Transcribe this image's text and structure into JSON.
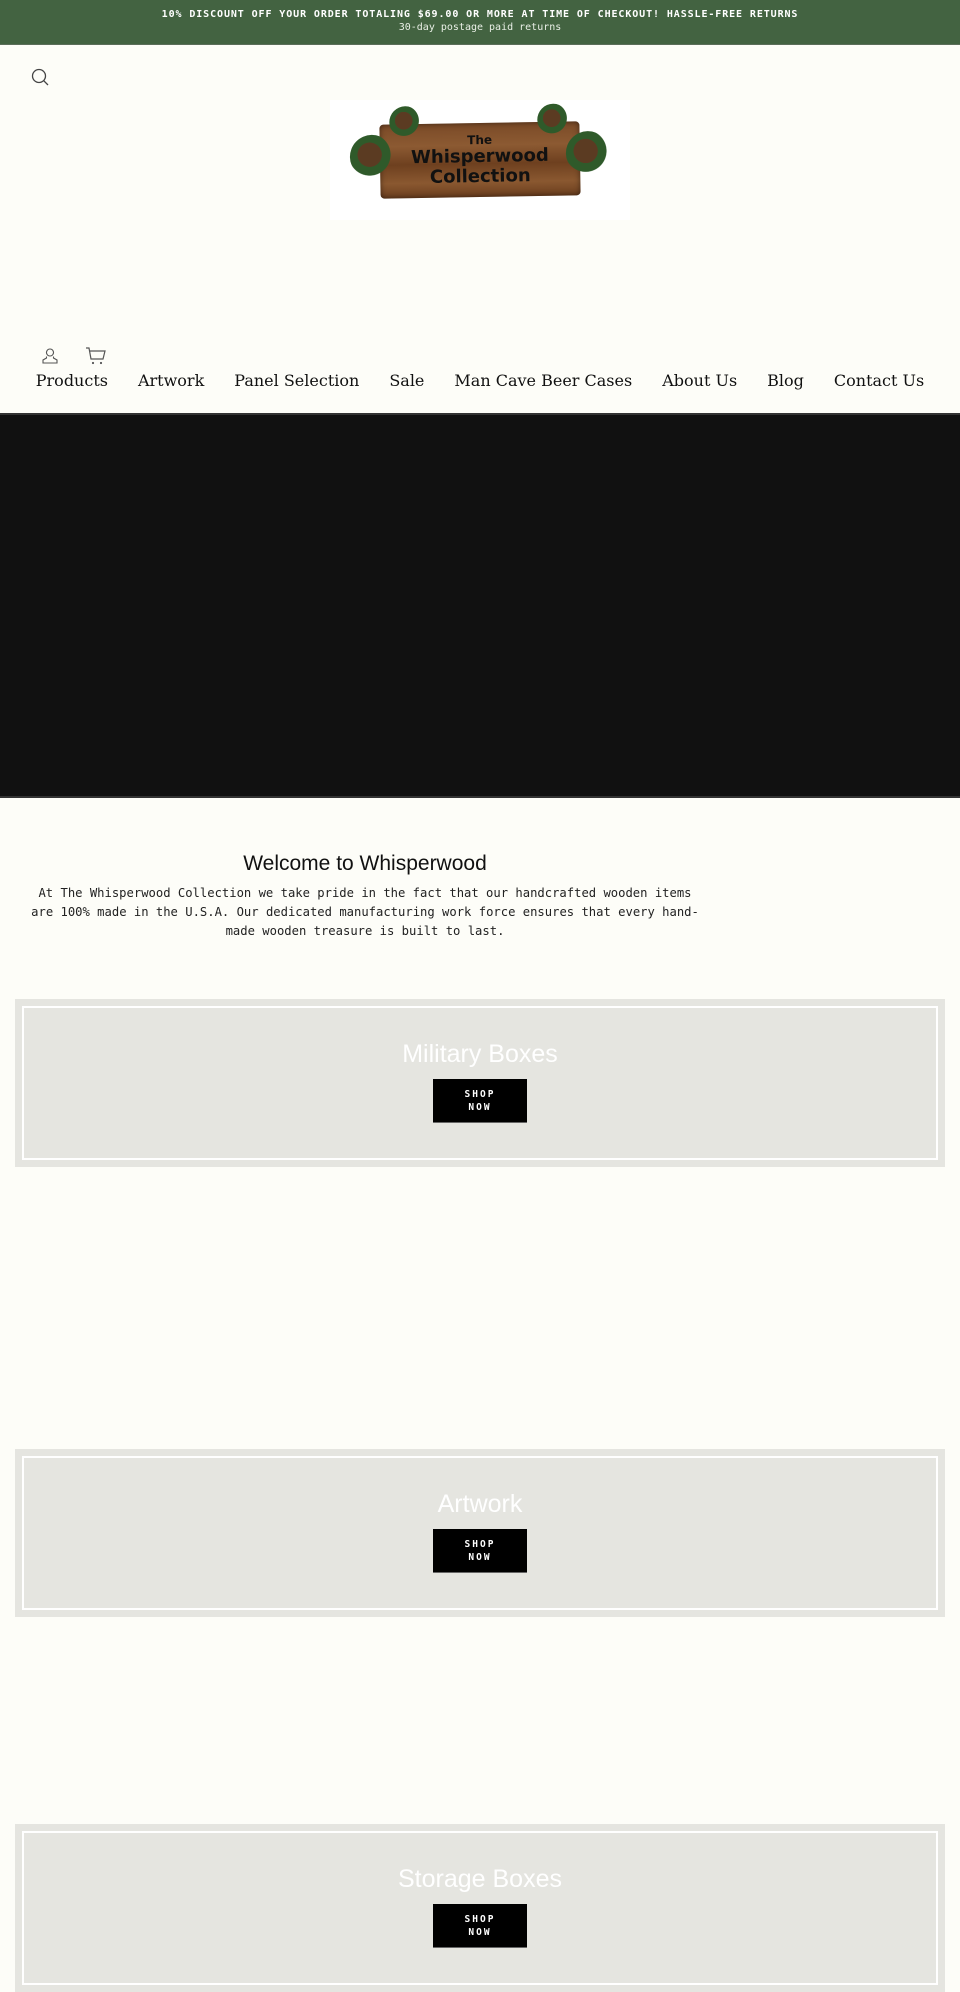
{
  "announcement": {
    "headline": "10% DISCOUNT OFF YOUR ORDER TOTALING $69.00 OR MORE AT TIME OF CHECKOUT! HASSLE-FREE RETURNS",
    "subline": "30-day postage paid returns"
  },
  "header": {
    "logo": {
      "line1": "The",
      "line2": "Whisperwood",
      "line3": "Collection"
    },
    "icons": [
      "search-icon",
      "account-icon",
      "cart-icon"
    ]
  },
  "nav": {
    "items": [
      {
        "label": "Products"
      },
      {
        "label": "Artwork"
      },
      {
        "label": "Panel Selection"
      },
      {
        "label": "Sale"
      },
      {
        "label": "Man Cave Beer Cases"
      },
      {
        "label": "About Us"
      },
      {
        "label": "Blog"
      },
      {
        "label": "Contact Us"
      }
    ]
  },
  "intro": {
    "title": "Welcome to Whisperwood",
    "body": "At The Whisperwood Collection we take pride in the fact that our handcrafted wooden items are 100% made in the U.S.A.  Our dedicated manufacturing work force ensures that every hand-made wooden treasure is built to last."
  },
  "collections": [
    {
      "title": "Military Boxes",
      "button": "SHOP NOW"
    },
    {
      "title": "Artwork",
      "button": "SHOP NOW"
    },
    {
      "title": "Storage Boxes",
      "button": "SHOP NOW"
    }
  ],
  "colors": {
    "announcement_bg": "#436341",
    "page_bg": "#fdfdf8",
    "hero_bg": "#111111",
    "card_bg": "#e5e5e0",
    "button_bg": "#000000"
  }
}
